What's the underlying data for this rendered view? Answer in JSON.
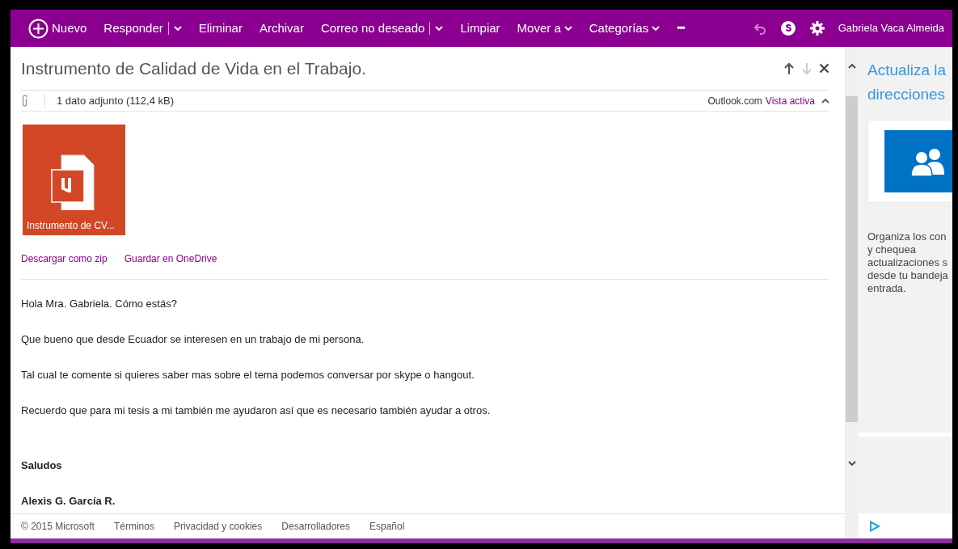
{
  "toolbar": {
    "items": [
      {
        "label": "Nuevo",
        "kind": "new"
      },
      {
        "label": "Responder",
        "kind": "split"
      },
      {
        "label": "Eliminar",
        "kind": "plain"
      },
      {
        "label": "Archivar",
        "kind": "plain"
      },
      {
        "label": "Correo no deseado",
        "kind": "split"
      },
      {
        "label": "Limpiar",
        "kind": "plain"
      },
      {
        "label": "Mover a",
        "kind": "dropdown"
      },
      {
        "label": "Categorías",
        "kind": "dropdown"
      },
      {
        "label": "•••",
        "kind": "more"
      }
    ],
    "undo_disabled": true,
    "user": "Gabriela Vaca Almeida"
  },
  "message": {
    "subject": "Instrumento de Calidad de Vida en el Trabajo.",
    "nav": {
      "previous_disabled": false,
      "next_disabled": true
    },
    "attachments_summary": "1 dato adjunto (112,4 kB)",
    "view_source": "Outlook.com",
    "view_link": "Vista activa",
    "attachment": {
      "name": "Instrumento de CV...",
      "color": "#d24726"
    },
    "attachment_actions": [
      "Descargar como zip",
      "Guardar en OneDrive"
    ],
    "body": [
      {
        "text": "Hola Mra. Gabriela. Cómo estás?",
        "bold": false
      },
      {
        "text": "Que bueno que desde Ecuador se interesen en un trabajo de mi persona.",
        "bold": false
      },
      {
        "text": "Tal cual te comente si quieres saber mas sobre el tema podemos conversar por skype o hangout.",
        "bold": false
      },
      {
        "text": "Recuerdo que para mi tesis a mi también me ayudaron así que es necesario también ayudar a otros.",
        "bold": false
      },
      {
        "text": "Saludos",
        "bold": true
      },
      {
        "text": "Alexis G. García R.",
        "bold": true
      }
    ]
  },
  "footer": [
    "© 2015 Microsoft",
    "Términos",
    "Privacidad y cookies",
    "Desarrolladores",
    "Español"
  ],
  "side_panel": {
    "title_lines": [
      "Actualiza la",
      "direcciones"
    ],
    "text_lines": [
      "Organiza los con",
      "y chequea",
      "actualizaciones s",
      "desde tu bandeja",
      "entrada."
    ]
  }
}
